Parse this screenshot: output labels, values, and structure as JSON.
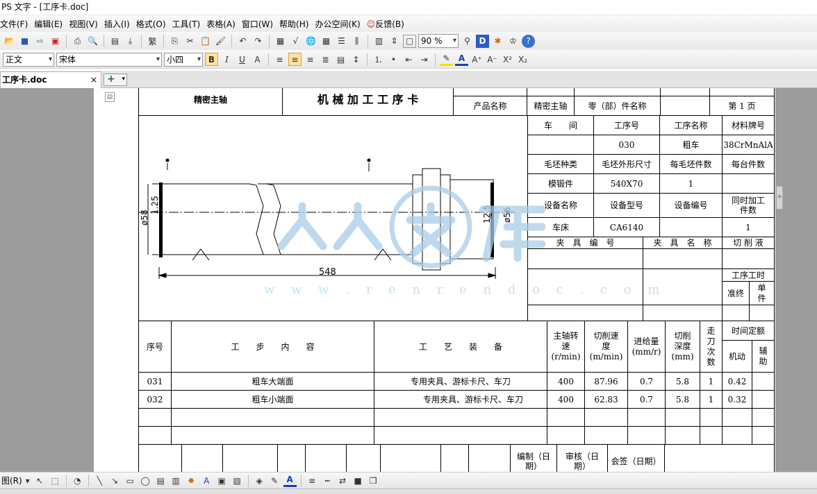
{
  "window": {
    "title": "PS 文字 - [工序卡.doc]"
  },
  "menu": [
    "文件(F)",
    "编辑(E)",
    "视图(V)",
    "插入(I)",
    "格式(O)",
    "工具(T)",
    "表格(A)",
    "窗口(W)",
    "帮助(H)",
    "办公空间(K)",
    "反馈(B)"
  ],
  "toolbar": {
    "zoom": "90 %"
  },
  "format_toolbar": {
    "style": "正文",
    "font": "宋体",
    "size": "小四",
    "bold": "B",
    "italic": "I",
    "underline": "U"
  },
  "tab": {
    "label": "工序卡.doc",
    "close": "×",
    "add": "+"
  },
  "card": {
    "part_name_cell": "精密主轴",
    "title": "机 械 加 工 工 序 卡",
    "product_name_label": "产品名称",
    "product_name": "精密主轴",
    "part_name_label": "零（部）件名称",
    "page": "第 1 页",
    "workshop_label": "车　　间",
    "op_no_label": "工序号",
    "op_name_label": "工序名称",
    "material_label": "材料牌号",
    "op_no": "030",
    "op_name": "粗车",
    "material": "38CrMnAlA",
    "blank_type_label": "毛坯种类",
    "blank_size_label": "毛坯外形尺寸",
    "per_blank_label": "每毛坯件数",
    "per_unit_label": "每台件数",
    "blank_type": "模锻件",
    "blank_size": "540X70",
    "per_blank": "1",
    "equip_name_label": "设备名称",
    "equip_model_label": "设备型号",
    "equip_no_label": "设备编号",
    "simul_label": "同时加工件数",
    "equip_name": "车床",
    "equip_model": "CA6140",
    "simul": "1",
    "fixture_no_label": "夹　具　编　号",
    "fixture_name_label": "夹　具　名　称",
    "coolant_label": "切 削 液",
    "op_time_label": "工序工时",
    "final_label": "准终",
    "unit_label": "单件"
  },
  "drawing": {
    "dim_length": "548",
    "dim_d1": "ø58",
    "dim_d2": "ø56",
    "rough_1": "1.25",
    "rough_2": "12.5"
  },
  "watermark": {
    "url": "w w w . r e n r e n d o c . c o m"
  },
  "steps": {
    "headers": {
      "no": "序号",
      "content": "工　　步　　内　　容",
      "equipment": "工　　艺　　装　　备",
      "speed": "主轴转速(r/min)",
      "cut_speed": "切削速度(m/min)",
      "feed": "进给量(mm/r)",
      "depth": "切削深度(mm)",
      "passes": "走刀次数",
      "time_quota": "时间定额",
      "machine": "机动",
      "aux": "辅助"
    },
    "rows": [
      {
        "no": "031",
        "content": "粗车大端面",
        "equipment": "专用夹具、游标卡尺、车刀",
        "speed": "400",
        "cut_speed": "87.96",
        "feed": "0.7",
        "depth": "5.8",
        "passes": "1",
        "machine": "0.42"
      },
      {
        "no": "032",
        "content": "粗车小端面",
        "equipment": "专用夹具、游标卡尺、车刀",
        "speed": "400",
        "cut_speed": "62.83",
        "feed": "0.7",
        "depth": "5.8",
        "passes": "1",
        "machine": "0.32"
      }
    ]
  },
  "footer": {
    "editor": "编制（日期）",
    "reviewer": "审核（日期）",
    "countersign": "会签（日期）"
  },
  "bottom_toolbar": {
    "draw": "图(R)"
  }
}
